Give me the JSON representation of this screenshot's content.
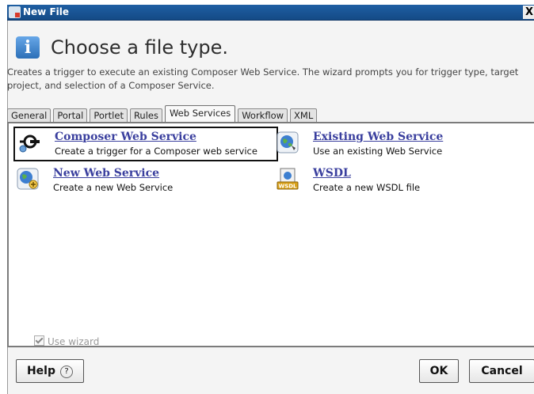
{
  "window": {
    "title": "New File",
    "close_glyph": "X"
  },
  "header": {
    "icon_glyph": "i",
    "title": "Choose a file type.",
    "description": "Creates a trigger to execute an existing Composer Web Service. The wizard prompts you for trigger type, target project, and selection of a Composer Service."
  },
  "tabs": [
    {
      "label": "General"
    },
    {
      "label": "Portal"
    },
    {
      "label": "Portlet"
    },
    {
      "label": "Rules"
    },
    {
      "label": "Web Services",
      "active": true
    },
    {
      "label": "Workflow"
    },
    {
      "label": "XML"
    }
  ],
  "items": [
    {
      "title": "Composer Web Service",
      "subtitle": "Create a trigger for a Composer web service",
      "icon": "composer-web-service-icon",
      "selected": true
    },
    {
      "title": "Existing Web Service",
      "subtitle": "Use an existing Web Service",
      "icon": "globe-icon"
    },
    {
      "title": "New Web Service",
      "subtitle": "Create a new Web Service",
      "icon": "globe-plus-icon"
    },
    {
      "title": "WSDL",
      "subtitle": "Create a new WSDL file",
      "icon": "wsdl-file-icon",
      "icon_text": "WSDL"
    }
  ],
  "footer": {
    "use_wizard_label": "Use wizard",
    "use_wizard_checked": true,
    "help_label": "Help",
    "help_glyph": "?",
    "ok_label": "OK",
    "cancel_label": "Cancel"
  },
  "colors": {
    "titlebar": "#1f5fa3",
    "link": "#3a3f9e",
    "accent": "#2c6fb7"
  }
}
